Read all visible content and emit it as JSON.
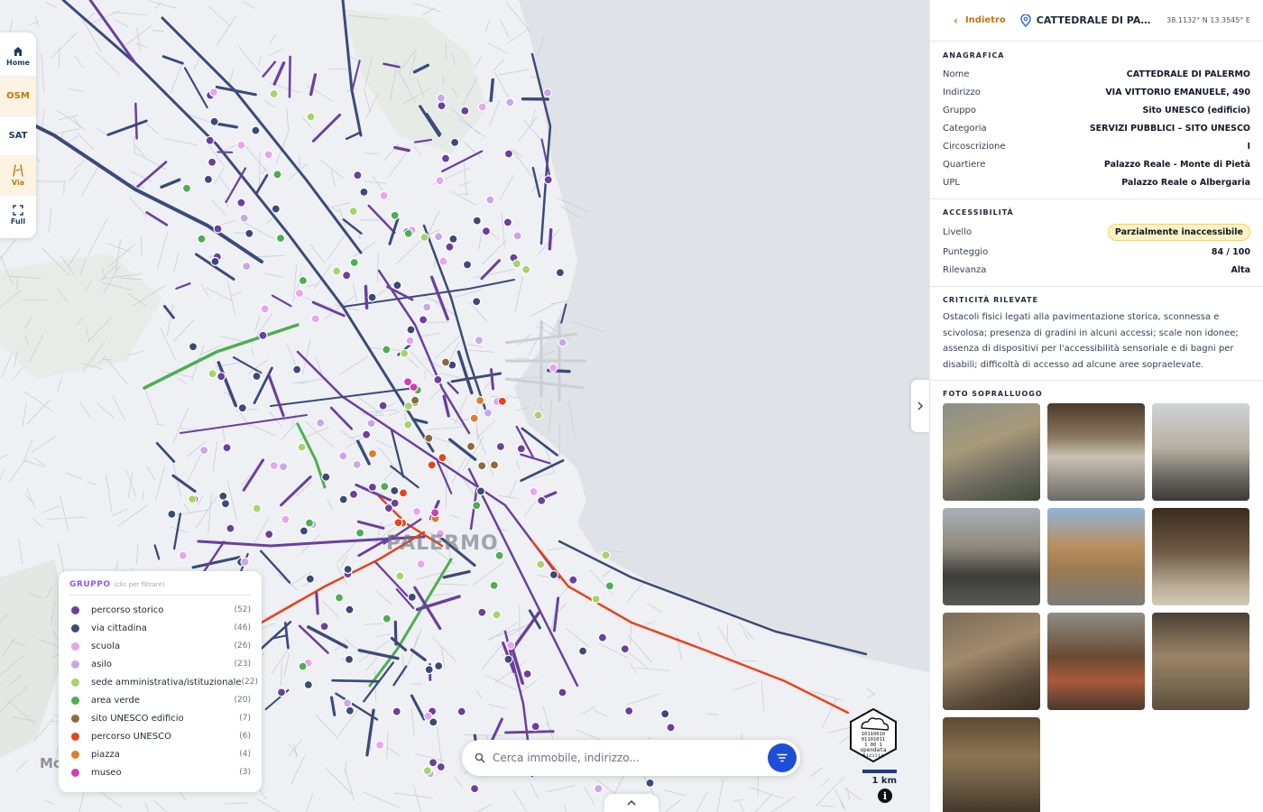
{
  "toolbar": {
    "home_label": "Home",
    "osm_label": "OSM",
    "sat_label": "SAT",
    "via_label": "Via",
    "full_label": "Full"
  },
  "map": {
    "city_label": "PALERMO",
    "area_label": "Mo"
  },
  "legend": {
    "title": "GRUPPO",
    "hint": "(clic per filtrare)",
    "items": [
      {
        "label": "percorso storico",
        "count": "(52)",
        "color": "#6b3fa0"
      },
      {
        "label": "via cittadina",
        "count": "(46)",
        "color": "#3b4a7a"
      },
      {
        "label": "scuola",
        "count": "(26)",
        "color": "#e9a3f0"
      },
      {
        "label": "asilo",
        "count": "(23)",
        "color": "#c7a6f0"
      },
      {
        "label": "sede amministrativa/istituzionale",
        "count": "(22)",
        "color": "#a5d46a"
      },
      {
        "label": "area verde",
        "count": "(20)",
        "color": "#4caf50"
      },
      {
        "label": "sito UNESCO edificio",
        "count": "(7)",
        "color": "#8d6a3a"
      },
      {
        "label": "percorso UNESCO",
        "count": "(6)",
        "color": "#e8431a"
      },
      {
        "label": "piazza",
        "count": "(4)",
        "color": "#e07b30"
      },
      {
        "label": "museo",
        "count": "(3)",
        "color": "#d63ab8"
      }
    ]
  },
  "search": {
    "placeholder": "Cerca immobile, indirizzo..."
  },
  "scale": {
    "label": "1 km"
  },
  "opendata": {
    "line1": "10110010",
    "line2": "01101011",
    "line3": "1  00 1",
    "line4": "opendata",
    "line5": "Sicilia"
  },
  "info_label": "i",
  "panel": {
    "back_label": "Indietro",
    "title": "CATTEDRALE DI PALERMO",
    "coords": "38.1132° N 13.3545° E",
    "anagrafica": {
      "title": "ANAGRAFICA",
      "rows": [
        {
          "k": "Nome",
          "v": "CATTEDRALE DI PALERMO"
        },
        {
          "k": "Indirizzo",
          "v": "VIA VITTORIO EMANUELE, 490"
        },
        {
          "k": "Gruppo",
          "v": "Sito UNESCO (edificio)"
        },
        {
          "k": "Categoria",
          "v": "SERVIZI PUBBLICI – SITO UNESCO"
        },
        {
          "k": "Circoscrizione",
          "v": "I"
        },
        {
          "k": "Quartiere",
          "v": "Palazzo Reale - Monte di Pietà"
        },
        {
          "k": "UPL",
          "v": "Palazzo Reale o Albergaria"
        }
      ]
    },
    "accessibilita": {
      "title": "ACCESSIBILITÀ",
      "livello_k": "Livello",
      "livello_v": "Parzialmente inaccessibile",
      "punteggio_k": "Punteggio",
      "punteggio_v": "84 / 100",
      "rilevanza_k": "Rilevanza",
      "rilevanza_v": "Alta"
    },
    "criticita": {
      "title": "CRITICITÀ RILEVATE",
      "text": "Ostacoli fisici legati alla pavimentazione storica, sconnessa e scivolosa; presenza di gradini in alcuni accessi; scale non idonee; assenza di dispositivi per l'accessibilità sensoriale e di bagni per disabili; difficoltà di accesso ad alcune aree sopraelevate."
    },
    "foto": {
      "title": "FOTO SOPRALLUOGO"
    }
  }
}
